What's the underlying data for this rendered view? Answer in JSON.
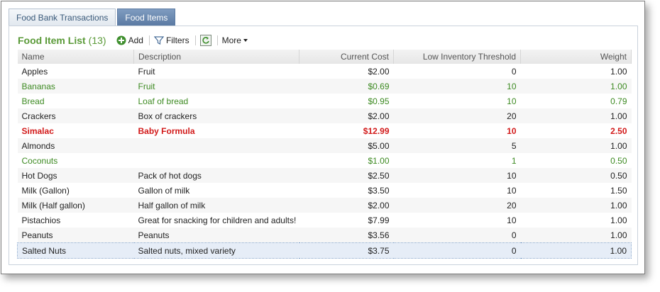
{
  "tabs": [
    {
      "label": "Food Bank Transactions",
      "active": false
    },
    {
      "label": "Food Items",
      "active": true
    }
  ],
  "list": {
    "title": "Food Item List",
    "count": "(13)",
    "add_label": "Add",
    "filters_label": "Filters",
    "more_label": "More"
  },
  "columns": [
    "Name",
    "Description",
    "Current Cost",
    "Low Inventory Threshold",
    "Weight"
  ],
  "rows": [
    {
      "name": "Apples",
      "description": "Fruit",
      "cost": "$2.00",
      "threshold": "0",
      "weight": "1.00",
      "style": "normal"
    },
    {
      "name": "Bananas",
      "description": "Fruit",
      "cost": "$0.69",
      "threshold": "10",
      "weight": "1.00",
      "style": "green"
    },
    {
      "name": "Bread",
      "description": "Loaf of bread",
      "cost": "$0.95",
      "threshold": "10",
      "weight": "0.79",
      "style": "green"
    },
    {
      "name": "Crackers",
      "description": "Box of crackers",
      "cost": "$2.00",
      "threshold": "20",
      "weight": "1.00",
      "style": "normal"
    },
    {
      "name": "Simalac",
      "description": "Baby Formula",
      "cost": "$12.99",
      "threshold": "10",
      "weight": "2.50",
      "style": "red"
    },
    {
      "name": "Almonds",
      "description": "",
      "cost": "$5.00",
      "threshold": "5",
      "weight": "1.00",
      "style": "normal"
    },
    {
      "name": "Coconuts",
      "description": "",
      "cost": "$1.00",
      "threshold": "1",
      "weight": "0.50",
      "style": "green"
    },
    {
      "name": "Hot Dogs",
      "description": "Pack of hot dogs",
      "cost": "$2.50",
      "threshold": "10",
      "weight": "0.50",
      "style": "normal"
    },
    {
      "name": "Milk (Gallon)",
      "description": "Gallon of milk",
      "cost": "$3.50",
      "threshold": "10",
      "weight": "1.50",
      "style": "normal"
    },
    {
      "name": "Milk (Half gallon)",
      "description": "Half gallon of milk",
      "cost": "$2.00",
      "threshold": "20",
      "weight": "1.00",
      "style": "normal"
    },
    {
      "name": "Pistachios",
      "description": "Great for snacking for children and adults!",
      "cost": "$7.99",
      "threshold": "10",
      "weight": "1.00",
      "style": "normal"
    },
    {
      "name": "Peanuts",
      "description": "Peanuts",
      "cost": "$3.56",
      "threshold": "0",
      "weight": "1.00",
      "style": "normal"
    },
    {
      "name": "Salted Nuts",
      "description": "Salted nuts, mixed variety",
      "cost": "$3.75",
      "threshold": "0",
      "weight": "1.00",
      "style": "selected"
    }
  ],
  "icons": {
    "add": "plus-circle-icon",
    "filter": "funnel-icon",
    "refresh": "refresh-icon",
    "more": "caret-down-icon"
  },
  "colors": {
    "title_green": "#5a9a38",
    "row_green": "#3d8a22",
    "row_red": "#d21a1a",
    "tab_active": "#5b7aa3"
  }
}
